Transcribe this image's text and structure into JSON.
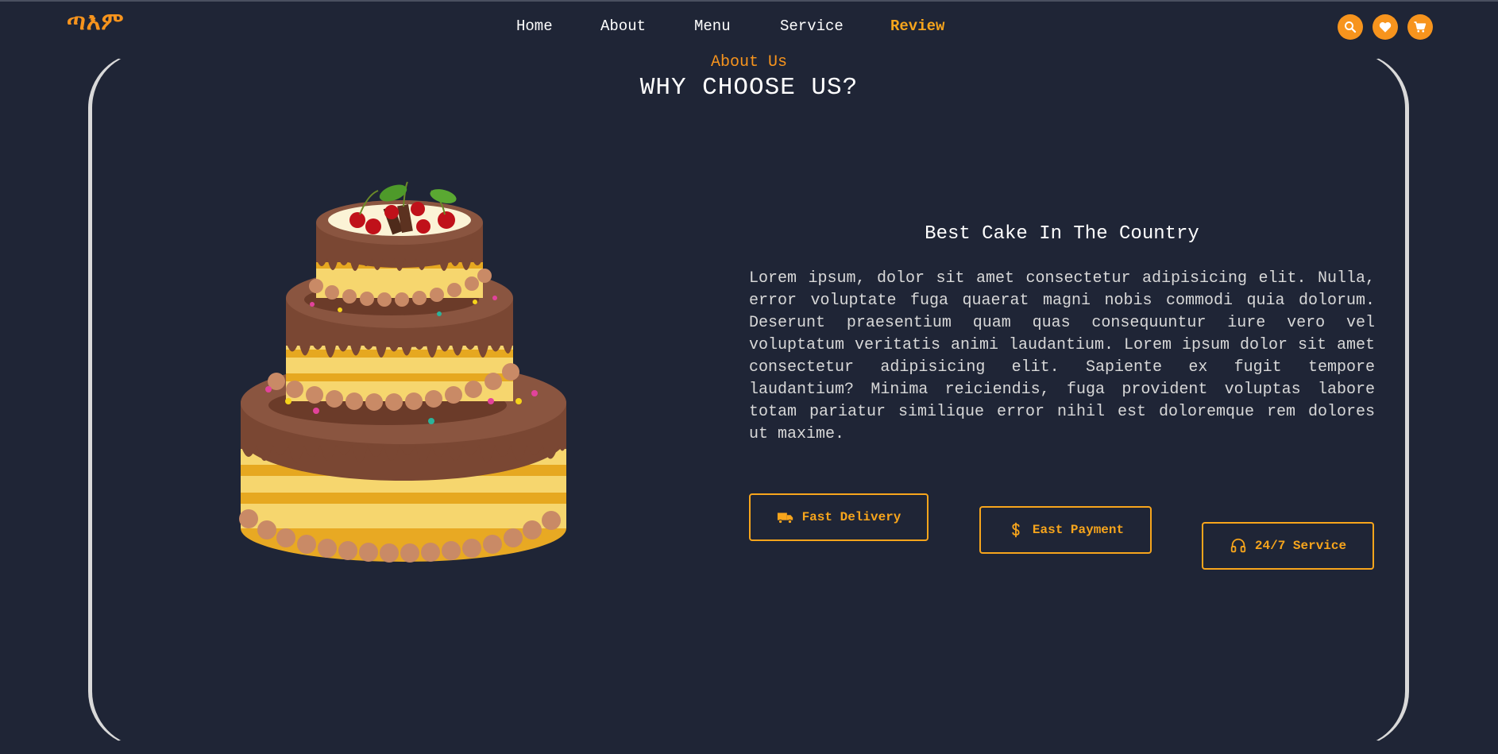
{
  "logo": "ጣእም",
  "nav": [
    {
      "label": "Home"
    },
    {
      "label": "About"
    },
    {
      "label": "Menu"
    },
    {
      "label": "Service"
    },
    {
      "label": "Review",
      "active": true
    }
  ],
  "header_icons": [
    "search-icon",
    "heart-icon",
    "cart-icon"
  ],
  "section": {
    "subheading": "About Us",
    "heading": "WHY CHOOSE US?"
  },
  "content": {
    "title": "Best Cake In The Country",
    "text": "Lorem ipsum, dolor sit amet consectetur adipisicing elit. Nulla, error voluptate fuga quaerat magni nobis commodi quia dolorum. Deserunt praesentium quam quas consequuntur iure vero vel voluptatum veritatis animi laudantium. Lorem ipsum dolor sit amet consectetur adipisicing elit. Sapiente ex fugit tempore laudantium? Minima reiciendis, fuga provident voluptas labore totam pariatur similique error nihil est doloremque rem dolores ut maxime."
  },
  "features": [
    {
      "label": "Fast Delivery",
      "icon": "truck-icon"
    },
    {
      "label": "East Payment",
      "icon": "dollar-icon"
    },
    {
      "label": "24/7 Service",
      "icon": "headset-icon"
    }
  ],
  "colors": {
    "background": "#1f2536",
    "accent": "#f7941d",
    "accent_light": "#f7a51c"
  }
}
